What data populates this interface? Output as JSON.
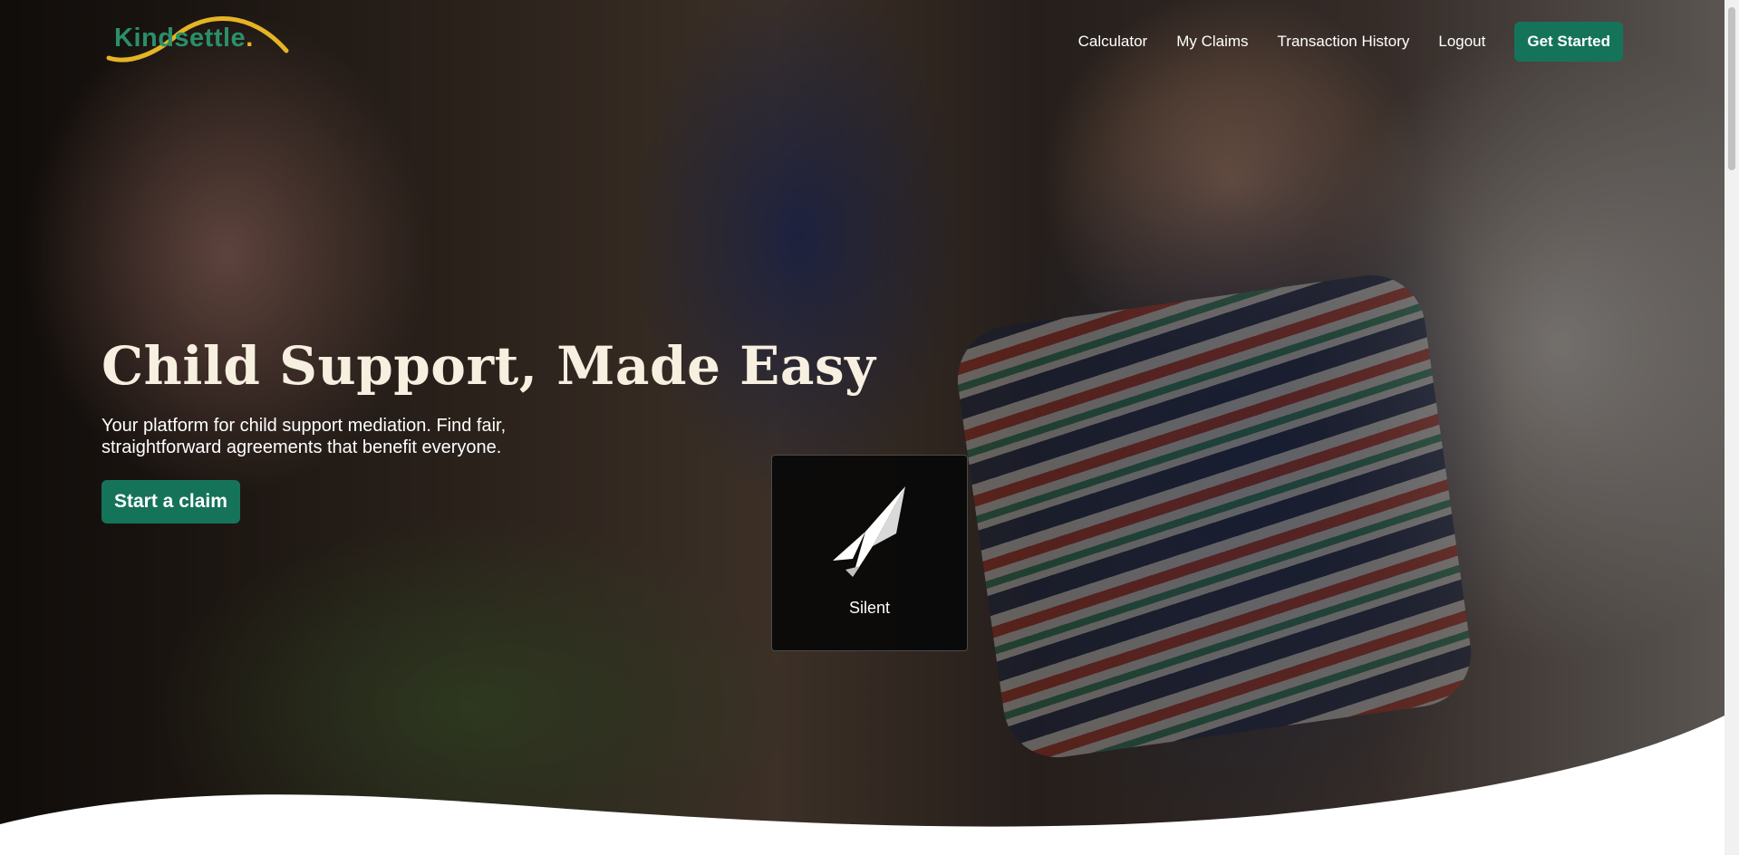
{
  "brand": {
    "name": "Kindsettle",
    "dot": ".",
    "primary_color": "#157359",
    "logo_green": "#2a8f6a",
    "logo_gold": "#e5b425"
  },
  "nav": {
    "items": [
      {
        "label": "Calculator"
      },
      {
        "label": "My Claims"
      },
      {
        "label": "Transaction History"
      },
      {
        "label": "Logout"
      }
    ],
    "cta_label": "Get Started"
  },
  "hero": {
    "title": "Child Support, Made Easy",
    "subtitle": "Your platform for child support mediation. Find fair, straightforward agreements that benefit everyone.",
    "cta_label": "Start a claim"
  },
  "overlay": {
    "icon": "silent-bird-icon",
    "label": "Silent"
  }
}
